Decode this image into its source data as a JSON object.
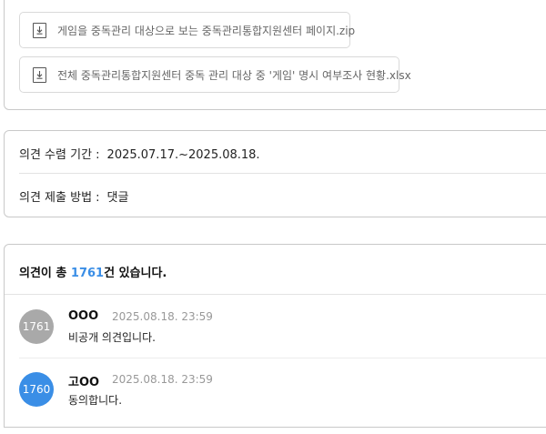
{
  "attachments": [
    {
      "icon": "download-file-icon",
      "name": "게임을 중독관리 대상으로 보는 중독관리통합지원센터 페이지.zip"
    },
    {
      "icon": "download-file-icon",
      "name": "전체 중독관리통합지원센터 중독 관리 대상 중 '게임' 명시 여부조사 현황.xlsx"
    }
  ],
  "info": {
    "period_label": "의견 수렴 기간 :",
    "period_value": "2025.07.17.~2025.08.18.",
    "method_label": "의견 제출 방법 :",
    "method_value": "댓글"
  },
  "opinions": {
    "heading_prefix": "의견이 총 ",
    "count": "1761",
    "heading_suffix": "건 있습니다.",
    "comments": [
      {
        "number": "1761",
        "author": "OOO",
        "time": "2025.08.18. 23:59",
        "text": "비공개 의견입니다.",
        "avatar_color": "#a9a9a9"
      },
      {
        "number": "1760",
        "author": "고OO",
        "time": "2025.08.18. 23:59",
        "text": "동의합니다.",
        "avatar_color": "#3a8ee6"
      }
    ]
  }
}
